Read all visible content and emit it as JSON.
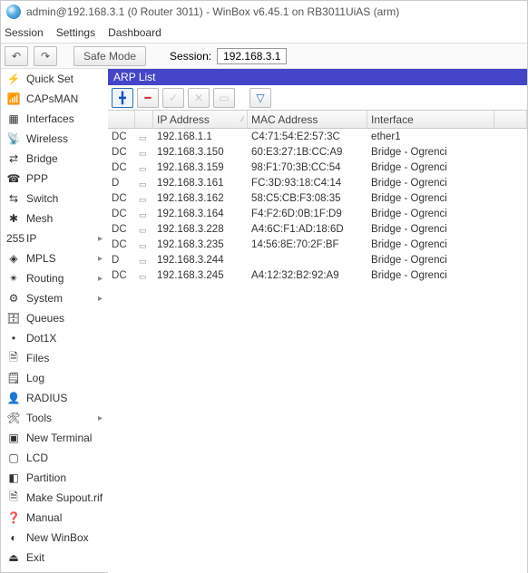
{
  "title": "admin@192.168.3.1 (0 Router 3011) - WinBox v6.45.1 on RB3011UiAS (arm)",
  "menu": {
    "session": "Session",
    "settings": "Settings",
    "dashboard": "Dashboard"
  },
  "toolbar": {
    "undo_glyph": "↶",
    "redo_glyph": "↷",
    "safe_mode": "Safe Mode",
    "session_label": "Session:",
    "session_ip": "192.168.3.1"
  },
  "sidebar": [
    {
      "icon": "⚡",
      "label": "Quick Set",
      "group": false
    },
    {
      "icon": "📶",
      "label": "CAPsMAN",
      "group": false
    },
    {
      "icon": "▦",
      "label": "Interfaces",
      "group": false
    },
    {
      "icon": "📡",
      "label": "Wireless",
      "group": false
    },
    {
      "icon": "⇄",
      "label": "Bridge",
      "group": false
    },
    {
      "icon": "☎",
      "label": "PPP",
      "group": false
    },
    {
      "icon": "⇆",
      "label": "Switch",
      "group": false
    },
    {
      "icon": "✱",
      "label": "Mesh",
      "group": false
    },
    {
      "icon": "255",
      "label": "IP",
      "group": true
    },
    {
      "icon": "◈",
      "label": "MPLS",
      "group": true
    },
    {
      "icon": "✴",
      "label": "Routing",
      "group": true
    },
    {
      "icon": "⚙",
      "label": "System",
      "group": true
    },
    {
      "icon": "🗄",
      "label": "Queues",
      "group": false
    },
    {
      "icon": "•",
      "label": "Dot1X",
      "group": false
    },
    {
      "icon": "🗎",
      "label": "Files",
      "group": false
    },
    {
      "icon": "🗒",
      "label": "Log",
      "group": false
    },
    {
      "icon": "👤",
      "label": "RADIUS",
      "group": false
    },
    {
      "icon": "🛠",
      "label": "Tools",
      "group": true
    },
    {
      "icon": "▣",
      "label": "New Terminal",
      "group": false
    },
    {
      "icon": "▢",
      "label": "LCD",
      "group": false
    },
    {
      "icon": "◧",
      "label": "Partition",
      "group": false
    },
    {
      "icon": "🗎",
      "label": "Make Supout.rif",
      "group": false
    },
    {
      "icon": "❓",
      "label": "Manual",
      "group": false
    },
    {
      "icon": "◐",
      "label": "New WinBox",
      "group": false
    },
    {
      "icon": "⏏",
      "label": "Exit",
      "group": false
    }
  ],
  "pane": {
    "title": "ARP List",
    "tools": {
      "add": "╋",
      "remove": "━",
      "enable": "✓",
      "disable": "✕",
      "comment": "▭",
      "filter": "▽"
    },
    "columns": {
      "flags": "",
      "iconcol": "",
      "ip": "IP Address",
      "mac": "MAC Address",
      "iface": "Interface"
    },
    "rows": [
      {
        "f": "DC",
        "ip": "192.168.1.1",
        "mac": "C4:71:54:E2:57:3C",
        "if": "ether1"
      },
      {
        "f": "DC",
        "ip": "192.168.3.150",
        "mac": "60:E3:27:1B:CC:A9",
        "if": "Bridge - Ogrenci"
      },
      {
        "f": "DC",
        "ip": "192.168.3.159",
        "mac": "98:F1:70:3B:CC:54",
        "if": "Bridge - Ogrenci"
      },
      {
        "f": "D",
        "ip": "192.168.3.161",
        "mac": "FC:3D:93:18:C4:14",
        "if": "Bridge - Ogrenci"
      },
      {
        "f": "DC",
        "ip": "192.168.3.162",
        "mac": "58:C5:CB:F3:08:35",
        "if": "Bridge - Ogrenci"
      },
      {
        "f": "DC",
        "ip": "192.168.3.164",
        "mac": "F4:F2:6D:0B:1F:D9",
        "if": "Bridge - Ogrenci"
      },
      {
        "f": "DC",
        "ip": "192.168.3.228",
        "mac": "A4:6C:F1:AD:18:6D",
        "if": "Bridge - Ogrenci"
      },
      {
        "f": "DC",
        "ip": "192.168.3.235",
        "mac": "14:56:8E:70:2F:BF",
        "if": "Bridge - Ogrenci"
      },
      {
        "f": "D",
        "ip": "192.168.3.244",
        "mac": "",
        "if": "Bridge - Ogrenci"
      },
      {
        "f": "DC",
        "ip": "192.168.3.245",
        "mac": "A4:12:32:B2:92:A9",
        "if": "Bridge - Ogrenci"
      }
    ]
  }
}
